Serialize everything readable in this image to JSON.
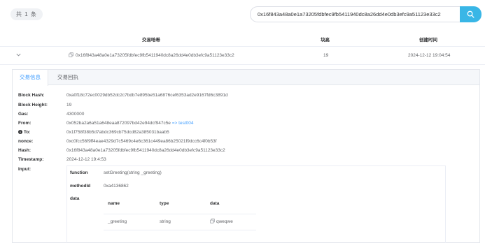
{
  "header": {
    "count_label": "共 1 条",
    "search_value": "0x16f843a48a0e1a73205fdbfec9fb5411940dc8a26dd4e0db3efc9a51123e33c2"
  },
  "table": {
    "columns": [
      "交易哈希",
      "块高",
      "创建时间"
    ],
    "row": {
      "hash": "0x16f843a48a0e1a73205fdbfec9fb5411940dc8a26dd4e0db3efc9a51123e33c2",
      "block": "19",
      "time": "2024-12-12 19:04:54"
    }
  },
  "tabs": [
    "交易信息",
    "交易回执"
  ],
  "details": {
    "block_hash_label": "Block Hash:",
    "block_hash": "0xa0f18c72ec0029db52dc2c7bdb7e895be51a6876cef6353ad2e9167fd6c3891d",
    "block_height_label": "Block Height:",
    "block_height": "19",
    "gas_label": "Gas:",
    "gas": "4300000",
    "from_label": "From:",
    "from": "0x052ba2a6a51a648eaa872097bd42e94dcf947c5e",
    "from_arrow": "=>",
    "from_name": "test004",
    "to_label": "To:",
    "to": "0x1f758f38b5d7abdc369cb75dcd82a385031baab5",
    "nonce_label": "nonce:",
    "nonce": "0xc0fcc56f9ff4eae4329d7c5469c4e6c361c449ea86b25021f9dcc6c4f0b53f",
    "hash_label": "Hash:",
    "hash": "0x16f843a48a0e1a73205fdbfec9fb5411940dc8a26dd4e0db3efc9a51123e33c2",
    "timestamp_label": "Timestamp:",
    "timestamp": "2024-12-12 19:4:53",
    "input_label": "Input:"
  },
  "input": {
    "function_label": "function",
    "function_value": "setGreeting(string _greeting)",
    "methodid_label": "methodId",
    "methodid_value": "0xa4136862",
    "data_label": "data",
    "data_columns": [
      "name",
      "type",
      "data"
    ],
    "data_row": {
      "name": "_greeting",
      "type": "string",
      "data": "qweqwe"
    }
  },
  "colors": {
    "accent": "#409eff",
    "search_button": "#39b6e6"
  }
}
